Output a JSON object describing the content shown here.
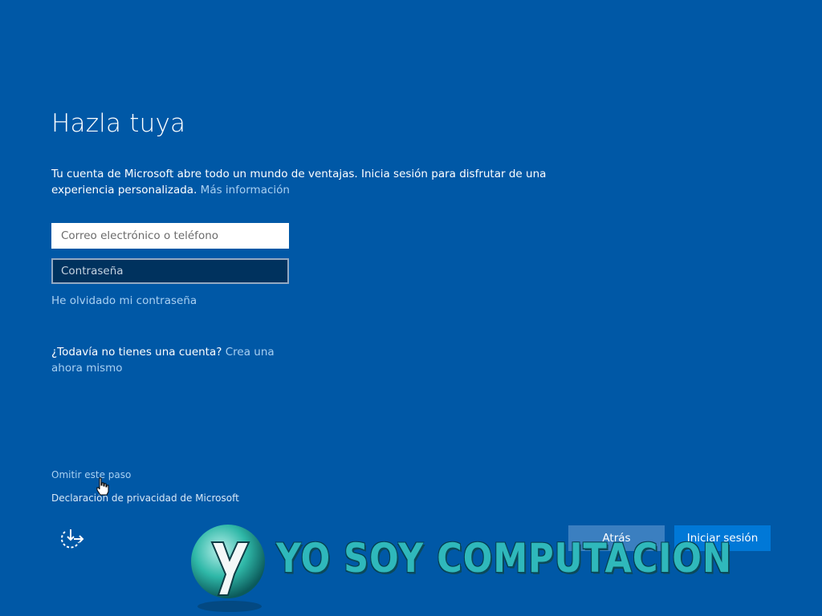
{
  "page": {
    "title": "Hazla tuya",
    "intro_text": "Tu cuenta de Microsoft abre todo un mundo de ventajas. Inicia sesión para disfrutar de una experiencia personalizada.",
    "intro_link": "Más información"
  },
  "form": {
    "email_placeholder": "Correo electrónico o teléfono",
    "email_value": "",
    "password_placeholder": "Contraseña",
    "password_value": "",
    "forgot_password": "He olvidado mi contraseña"
  },
  "signup": {
    "question": "¿Todavía no tienes una cuenta?",
    "link": "Crea una ahora mismo"
  },
  "footer": {
    "skip_link": "Omitir este paso",
    "privacy_link": "Declaración de privacidad de Microsoft",
    "accessibility_icon": "ease-of-access-icon"
  },
  "buttons": {
    "back_label": "Atrás",
    "signin_label": "Iniciar sesión"
  },
  "watermark": {
    "text": "YO SOY COMPUTACION"
  },
  "colors": {
    "background": "#0058a6",
    "link": "#a8d0f2",
    "primary_button": "#0078d7",
    "secondary_button": "#3b7fc0"
  }
}
